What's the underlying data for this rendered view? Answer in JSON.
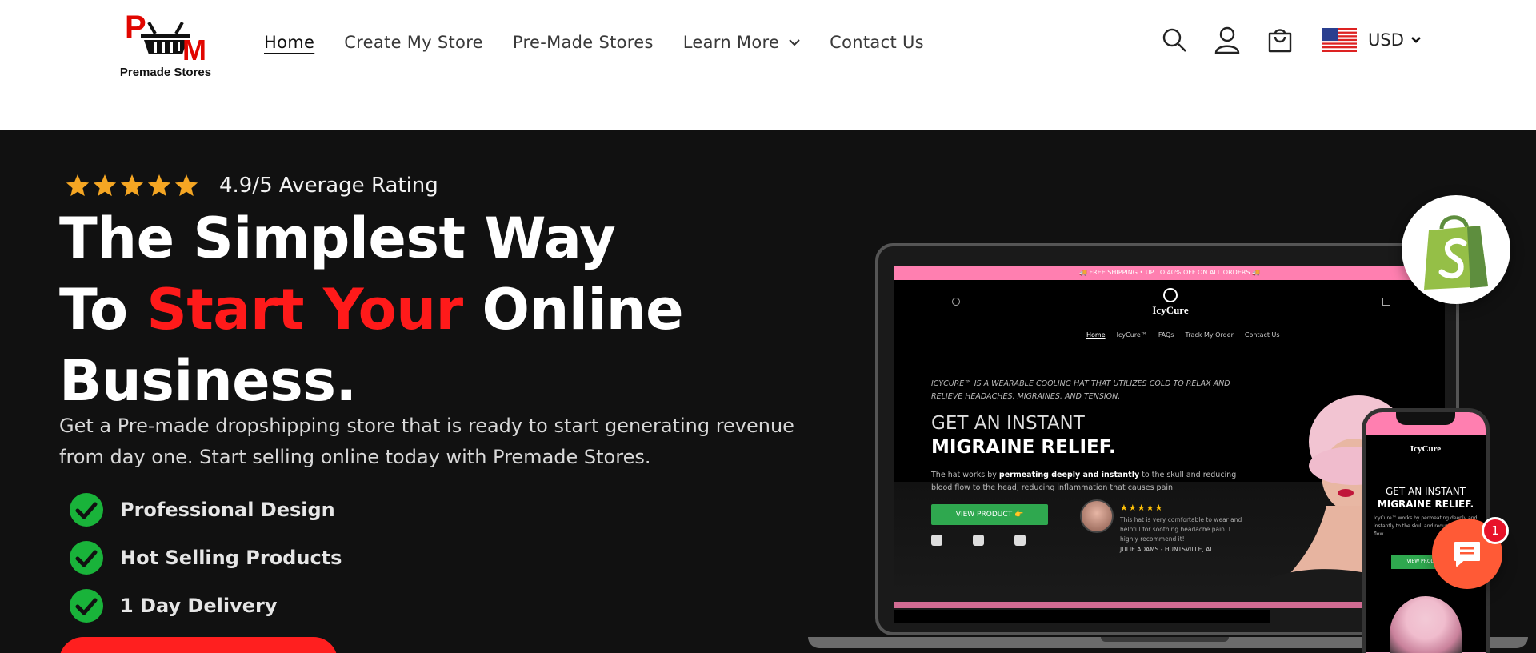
{
  "brand": {
    "logo_letter_p": "P",
    "logo_letter_m": "M",
    "logo_text": "Premade Stores",
    "primary_color": "#ff1a1a",
    "dark_bg": "#111111"
  },
  "nav": {
    "items": [
      {
        "label": "Home",
        "active": true
      },
      {
        "label": "Create My Store",
        "active": false
      },
      {
        "label": "Pre-Made Stores",
        "active": false
      },
      {
        "label": "Learn More",
        "active": false,
        "has_dropdown": true
      },
      {
        "label": "Contact Us",
        "active": false
      }
    ]
  },
  "header_icons": {
    "search": "search-icon",
    "account": "account-icon",
    "cart": "cart-icon"
  },
  "currency": {
    "code": "USD",
    "flag": "us-flag-icon"
  },
  "hero": {
    "rating_text": "4.9/5 Average Rating",
    "stars": 5,
    "headline_line1": "The Simplest Way",
    "headline_line2_prefix": "To ",
    "headline_line2_highlight": "Start Your",
    "headline_line2_suffix": " Online",
    "headline_line3": "Business.",
    "subtext": "Get a Pre-made dropshipping store that is ready to start generating revenue from day one. Start selling online today with Premade Stores.",
    "features": [
      "Professional Design",
      "Hot Selling Products",
      "1 Day Delivery"
    ]
  },
  "mockup": {
    "banner": "🚚 FREE SHIPPING • UP TO 40% OFF ON ALL ORDERS 🚚",
    "brand": "IcyCure",
    "nav": [
      "Home",
      "IcyCure™",
      "FAQs",
      "Track My Order",
      "Contact Us"
    ],
    "tagline": "ICYCURE™ IS A WEARABLE COOLING HAT THAT UTILIZES COLD TO RELAX AND RELIEVE HEADACHES, MIGRAINES, AND TENSION.",
    "heading1": "GET AN INSTANT",
    "heading2": "MIGRAINE RELIEF.",
    "body_prefix": "The hat works by ",
    "body_bold": "permeating deeply and instantly",
    "body_suffix": " to the skull and reducing blood flow to the head, reducing inflammation that causes pain.",
    "button": "VIEW PRODUCT 👉",
    "review_stars": "★★★★★",
    "review_text": "This hat is very comfortable to wear and helpful for soothing headache pain. I highly recommend it!",
    "review_author": "JULIE ADAMS - HUNTSVILLE, AL",
    "phone_heading1": "GET AN INSTANT",
    "phone_heading2": "MIGRAINE RELIEF.",
    "phone_body": "IcyCure™ works by permeating deeply and instantly to the skull and reducing blood flow...",
    "phone_button": "VIEW PRODUCT"
  },
  "chat": {
    "badge_count": "1"
  }
}
